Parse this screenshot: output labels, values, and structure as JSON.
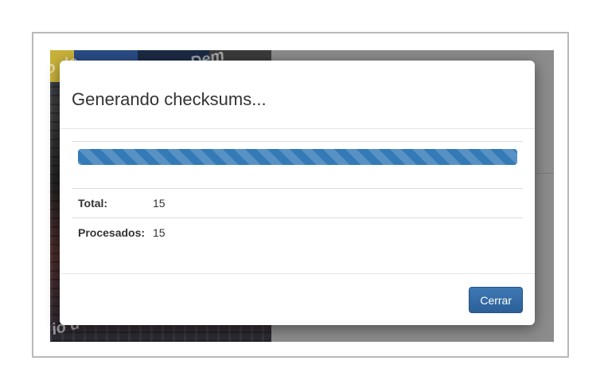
{
  "modal": {
    "title": "Generando checksums...",
    "progress_percent": 100,
    "stats": [
      {
        "label": "Total:",
        "value": "15"
      },
      {
        "label": "Procesados:",
        "value": "15"
      }
    ],
    "close_label": "Cerrar"
  },
  "background": {
    "watermark_fragments": [
      "o de",
      "Dem",
      "io d"
    ]
  },
  "colors": {
    "progress_bar": "#337ab7",
    "primary_button": "#2b5f97",
    "backdrop": "#8c8c8c"
  }
}
